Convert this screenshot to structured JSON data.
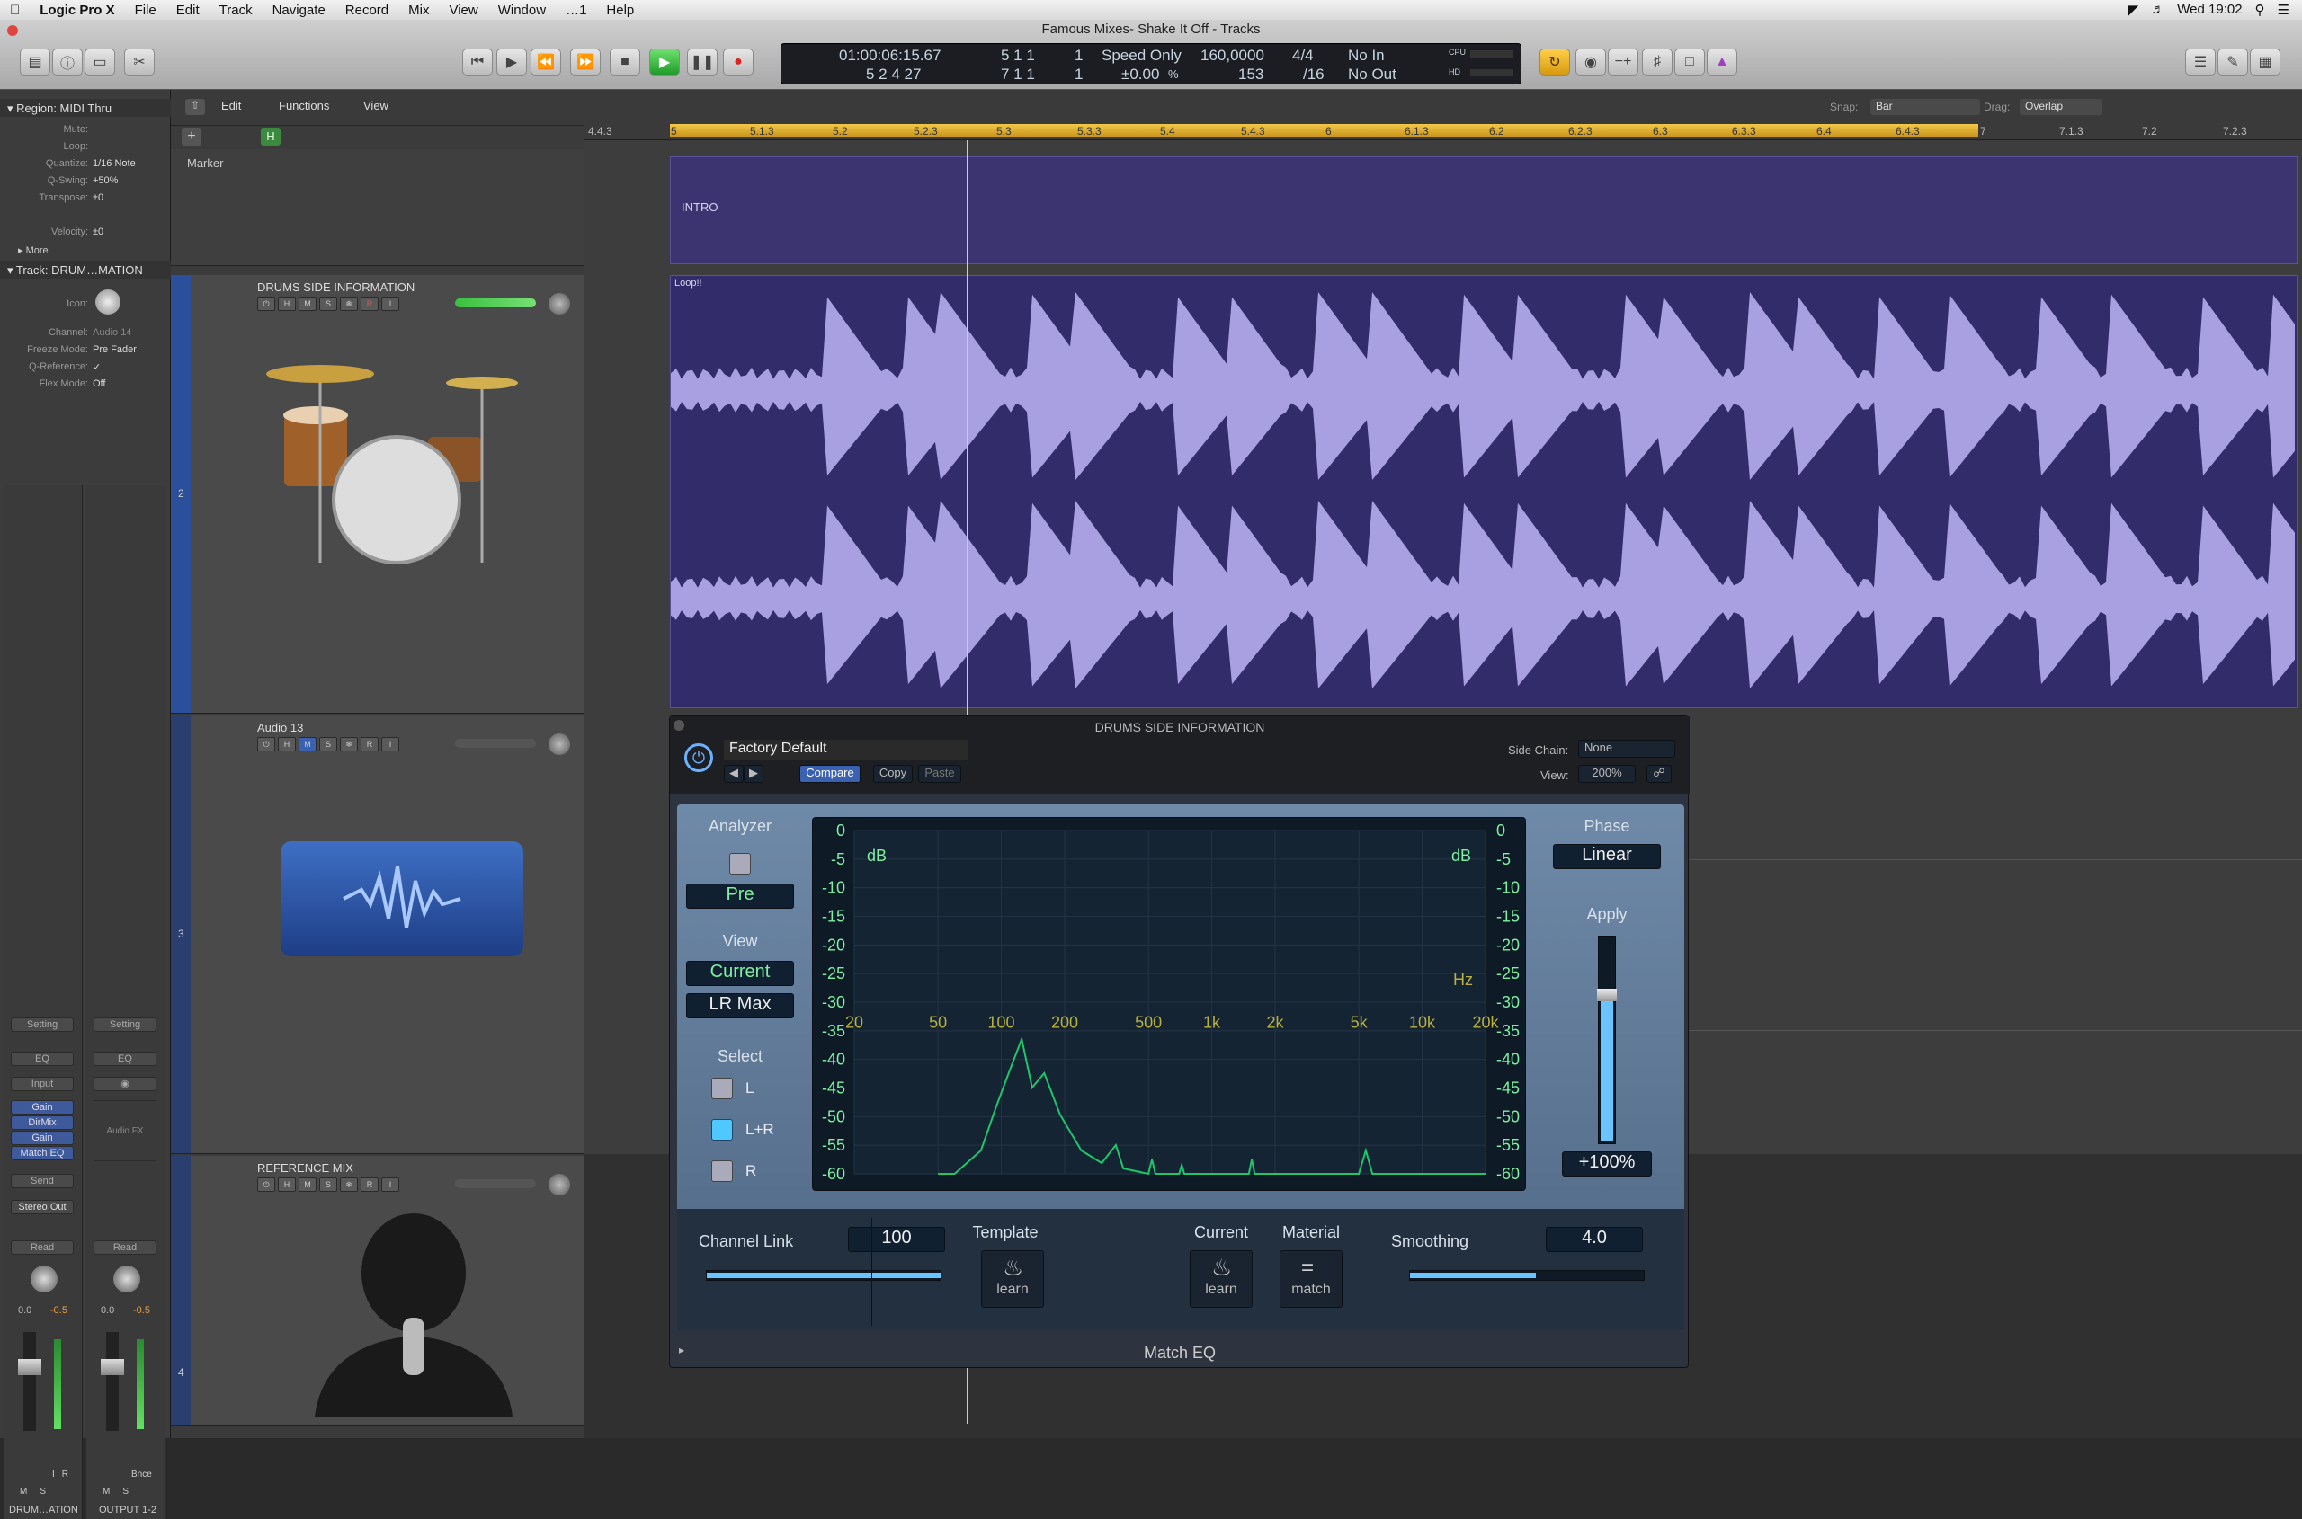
{
  "menubar": {
    "app": "Logic Pro X",
    "items": [
      "File",
      "Edit",
      "Track",
      "Navigate",
      "Record",
      "Mix",
      "View",
      "Window",
      "…1",
      "Help"
    ],
    "clock": "Wed 19:02"
  },
  "window": {
    "title": "Famous Mixes- Shake It Off - Tracks"
  },
  "lcd": {
    "time": "01:00:06:15.67",
    "bars": "5  2  4    27",
    "pos1": "5   1   1",
    "pos1b": "1",
    "pos2": "7   1   1",
    "pos2b": "1",
    "mode": "Speed Only",
    "modeval": "±0.00",
    "modepct": "%",
    "tempo": "160,0000",
    "tempo2": "153",
    "sig": "4/4",
    "sig2": "/16",
    "in": "No In",
    "out": "No Out",
    "cpu": "CPU",
    "hd": "HD"
  },
  "inspector": {
    "region_header": "Region: MIDI Thru",
    "region_rows": [
      {
        "k": "Mute:",
        "v": ""
      },
      {
        "k": "Loop:",
        "v": ""
      },
      {
        "k": "Quantize:",
        "v": "1/16 Note"
      },
      {
        "k": "Q-Swing:",
        "v": "+50%"
      },
      {
        "k": "Transpose:",
        "v": "±0"
      },
      {
        "k": "Velocity:",
        "v": "±0"
      }
    ],
    "more": "More",
    "track_header": "Track:  DRUM…MATION",
    "track_rows": [
      {
        "k": "Icon:",
        "v": ""
      },
      {
        "k": "Channel:",
        "v": "Audio 14"
      },
      {
        "k": "Freeze Mode:",
        "v": "Pre Fader"
      },
      {
        "k": "Q-Reference:",
        "v": "✓"
      },
      {
        "k": "Flex Mode:",
        "v": "Off"
      }
    ]
  },
  "strips": [
    {
      "setting": "Setting",
      "eq": "EQ",
      "input": "Input",
      "plugins": [
        "Gain",
        "DirMix",
        "Gain",
        "Match EQ"
      ],
      "send": "Send",
      "out": "Stereo Out",
      "auto": "Read",
      "vol": "0.0",
      "pan": "-0.5",
      "name": "DRUM…ATION",
      "btns": [
        "M",
        "S"
      ],
      "ir": [
        "I",
        "R"
      ]
    },
    {
      "setting": "Setting",
      "eq": "EQ",
      "input": "",
      "plugins": [],
      "audiofx": "Audio FX",
      "send": "",
      "out": "",
      "auto": "Read",
      "vol": "0.0",
      "pan": "-0.5",
      "name": "OUTPUT 1-2",
      "btns": [
        "M",
        "S"
      ],
      "ir": [
        "Bnce"
      ]
    }
  ],
  "tracktb": {
    "edit": "Edit",
    "functions": "Functions",
    "view": "View",
    "snap_label": "Snap:",
    "snap": "Bar",
    "drag_label": "Drag:",
    "drag": "Overlap",
    "marker": "Marker"
  },
  "tracks": [
    {
      "num": "2",
      "name": "DRUMS SIDE INFORMATION"
    },
    {
      "num": "3",
      "name": "Audio 13"
    },
    {
      "num": "4",
      "name": "REFERENCE MIX"
    }
  ],
  "ruler": [
    "4.4.3",
    "5",
    "5.1.3",
    "5.2",
    "5.2.3",
    "5.3",
    "5.3.3",
    "5.4",
    "5.4.3",
    "6",
    "6.1.3",
    "6.2",
    "6.2.3",
    "6.3",
    "6.3.3",
    "6.4",
    "6.4.3",
    "7",
    "7.1.3",
    "7.2",
    "7.2.3"
  ],
  "marker_region": "INTRO",
  "audio_region": "Loop!!",
  "plugin": {
    "title": "DRUMS SIDE INFORMATION",
    "preset": "Factory Default",
    "compare": "Compare",
    "copy": "Copy",
    "paste": "Paste",
    "sidechain_label": "Side Chain:",
    "sidechain": "None",
    "view_label": "View:",
    "view": "200%",
    "analyzer": "Analyzer",
    "pre": "Pre",
    "view_h": "View",
    "current": "Current",
    "lrmax": "LR Max",
    "select": "Select",
    "sel_l": "L",
    "sel_lr": "L+R",
    "sel_r": "R",
    "phase": "Phase",
    "linear": "Linear",
    "apply": "Apply",
    "apply_val": "+100%",
    "db_left": [
      "0",
      "-5",
      "-10",
      "-15",
      "-20",
      "-25",
      "-30",
      "-35",
      "-40",
      "-45",
      "-50",
      "-55",
      "-60"
    ],
    "db_right": [
      "0",
      "-5",
      "-10",
      "-15",
      "-20",
      "-25",
      "-30",
      "-35",
      "-40",
      "-45",
      "-50",
      "-55",
      "-60"
    ],
    "db": "dB",
    "hz": "Hz",
    "freq": [
      "20",
      "50",
      "100",
      "200",
      "500",
      "1k",
      "2k",
      "5k",
      "10k",
      "20k"
    ],
    "channel_link": "Channel Link",
    "channel_link_val": "100",
    "template": "Template",
    "current_h": "Current",
    "material": "Material",
    "learn": "learn",
    "match": "match",
    "smoothing": "Smoothing",
    "smoothing_val": "4.0",
    "footer": "Match EQ",
    "apply_level": 0.72,
    "channel_link_level": 1.0,
    "smoothing_level": 0.54,
    "colors": {
      "curve": "#22c46a",
      "lcd_text": "#7ef0a0"
    }
  }
}
